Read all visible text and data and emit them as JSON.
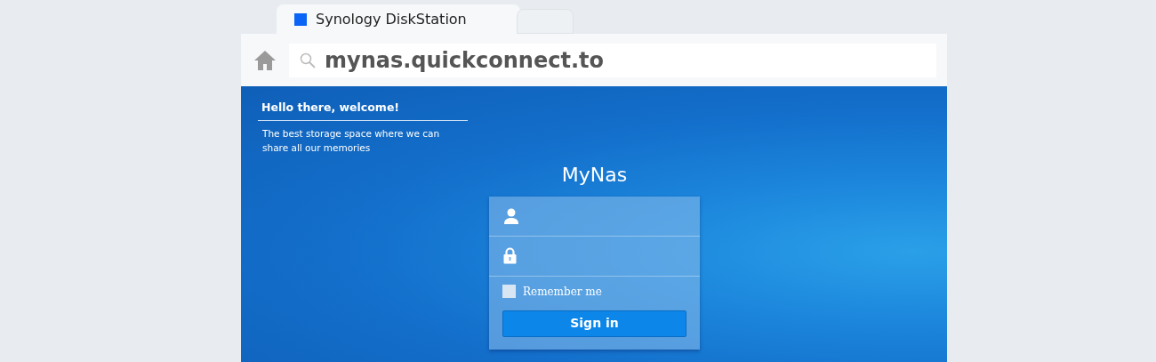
{
  "tabs": [
    {
      "label": "Synology DiskStation",
      "selected": true
    },
    {
      "selected": false
    }
  ],
  "address_bar": {
    "url": "mynas.quickconnect.to"
  },
  "welcome": {
    "title": "Hello there, welcome!",
    "message": "The best storage space where we can share all our memories"
  },
  "login": {
    "title": "MyNas",
    "remember": {
      "label": "Remember me",
      "checked": false
    },
    "button": "Sign in"
  }
}
